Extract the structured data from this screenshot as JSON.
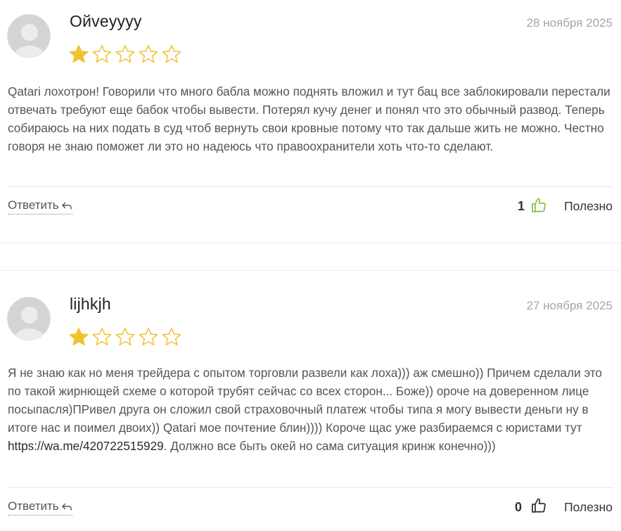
{
  "reviews": [
    {
      "author": "Ойveyyyy",
      "date": "28 ноября 2025",
      "rating": 1,
      "max_rating": 5,
      "text": "Qatari лохотрон! Говорили что много бабла можно поднять вложил и тут бац все заблокировали перестали отвечать требуют еще бабок чтобы вывести. Потерял кучу денег и понял что это обычный развод. Теперь собираюсь на них подать в суд чтоб вернуть свои кровные потому что так дальше жить не можно. Честно говоря не знаю поможет ли это но надеюсь что правоохранители хоть что-то сделают.",
      "reply_label": "Ответить",
      "votes": "1",
      "helpful_label": "Полезно",
      "thumb_color": "#8bc34a"
    },
    {
      "author": "lijhkjh",
      "date": "27 ноября 2025",
      "rating": 1,
      "max_rating": 5,
      "text_before_link": "Я не знаю как но меня трейдера с опытом торговли развели как лоха))) аж смешно)) Причем сделали это по такой жирнющей схеме о которой трубят сейчас со всех сторон... Боже)) ороче на доверенном лице посыпасля)ПРивел друга он сложил свой страховочный платеж чтобы типа я могу вывести деньги ну в итоге нас и поимел двоих)) Qatari мое почтение блин)))) Короче щас уже разбираемся с юристами тут ",
      "link": "https://wa.me/420722515929",
      "text_after_link": ". Должно все быть окей но сама ситуация кринж конечно)))",
      "reply_label": "Ответить",
      "votes": "0",
      "helpful_label": "Полезно",
      "thumb_color": "#333333"
    }
  ],
  "colors": {
    "star_filled": "#f2c12e",
    "star_outline": "#f2c12e",
    "text": "#555555",
    "date": "#a6a6a6"
  },
  "icons": {
    "avatar": "user-silhouette-icon",
    "star": "star-icon",
    "reply": "reply-arrow-icon",
    "thumb": "thumbs-up-icon"
  }
}
